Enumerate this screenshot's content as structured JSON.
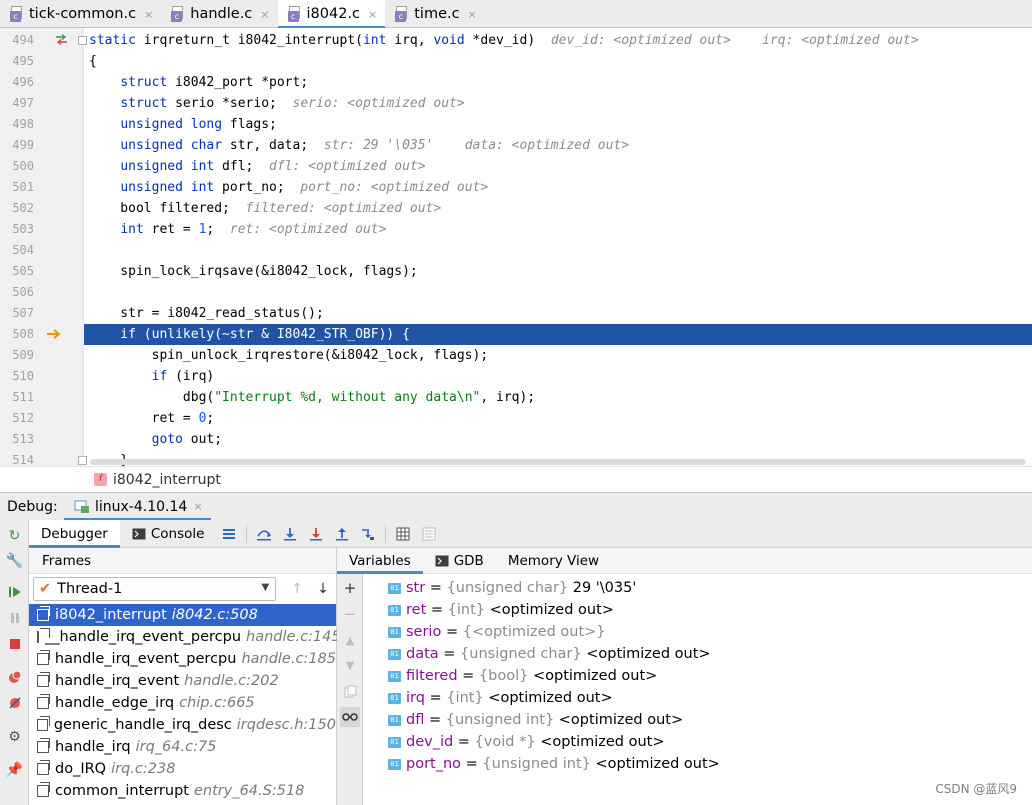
{
  "editor_tabs": [
    {
      "label": "tick-common.c",
      "active": false
    },
    {
      "label": "handle.c",
      "active": false
    },
    {
      "label": "i8042.c",
      "active": true
    },
    {
      "label": "time.c",
      "active": false
    }
  ],
  "file_icon_letter": "c",
  "close_glyph": "×",
  "code_lines": [
    {
      "num": "494",
      "code": [
        [
          "kw",
          "static "
        ],
        [
          "",
          "irqreturn_t i8042_interrupt("
        ],
        [
          "kw",
          "int"
        ],
        [
          "",
          " irq, "
        ],
        [
          "kw",
          "void"
        ],
        [
          "",
          " *dev_id)  "
        ],
        [
          "hint",
          "dev_id: <optimized out>    irq: <optimized out>"
        ]
      ]
    },
    {
      "num": "495",
      "code": [
        [
          "",
          "{"
        ]
      ]
    },
    {
      "num": "496",
      "code": [
        [
          "",
          "    "
        ],
        [
          "kw",
          "struct"
        ],
        [
          "",
          " i8042_port *port;"
        ]
      ]
    },
    {
      "num": "497",
      "code": [
        [
          "",
          "    "
        ],
        [
          "kw",
          "struct"
        ],
        [
          "",
          " serio *serio;  "
        ],
        [
          "hint",
          "serio: <optimized out>"
        ]
      ]
    },
    {
      "num": "498",
      "code": [
        [
          "",
          "    "
        ],
        [
          "kw",
          "unsigned long"
        ],
        [
          "",
          " flags;"
        ]
      ]
    },
    {
      "num": "499",
      "code": [
        [
          "",
          "    "
        ],
        [
          "kw",
          "unsigned char"
        ],
        [
          "",
          " str, data;  "
        ],
        [
          "hint",
          "str: "
        ],
        [
          "hintv",
          "29 '\\035'"
        ],
        [
          "hint",
          "    data: <optimized out>"
        ]
      ]
    },
    {
      "num": "500",
      "code": [
        [
          "",
          "    "
        ],
        [
          "kw",
          "unsigned int"
        ],
        [
          "",
          " dfl;  "
        ],
        [
          "hint",
          "dfl: <optimized out>"
        ]
      ]
    },
    {
      "num": "501",
      "code": [
        [
          "",
          "    "
        ],
        [
          "kw",
          "unsigned int"
        ],
        [
          "",
          " port_no;  "
        ],
        [
          "hint",
          "port_no: <optimized out>"
        ]
      ]
    },
    {
      "num": "502",
      "code": [
        [
          "",
          "    bool filtered;  "
        ],
        [
          "hint",
          "filtered: <optimized out>"
        ]
      ]
    },
    {
      "num": "503",
      "code": [
        [
          "",
          "    "
        ],
        [
          "kw",
          "int"
        ],
        [
          "",
          " ret = "
        ],
        [
          "numl",
          "1"
        ],
        [
          "",
          ";  "
        ],
        [
          "hint",
          "ret: <optimized out>"
        ]
      ]
    },
    {
      "num": "504",
      "code": []
    },
    {
      "num": "505",
      "code": [
        [
          "",
          "    spin_lock_irqsave(&i8042_lock, flags);"
        ]
      ]
    },
    {
      "num": "506",
      "code": []
    },
    {
      "num": "507",
      "code": [
        [
          "",
          "    str = i8042_read_status();"
        ]
      ]
    },
    {
      "num": "508",
      "code": [
        [
          "",
          "    if (unlikely(~str & I8042_STR_OBF)) {"
        ]
      ],
      "highlight": true
    },
    {
      "num": "509",
      "code": [
        [
          "",
          "        spin_unlock_irqrestore(&i8042_lock, flags);"
        ]
      ]
    },
    {
      "num": "510",
      "code": [
        [
          "",
          "        "
        ],
        [
          "kw",
          "if"
        ],
        [
          "",
          " (irq)"
        ]
      ]
    },
    {
      "num": "511",
      "code": [
        [
          "",
          "            dbg("
        ],
        [
          "str",
          "\"Interrupt %d, without any data\\n\""
        ],
        [
          "",
          ", irq);"
        ]
      ]
    },
    {
      "num": "512",
      "code": [
        [
          "",
          "        ret = "
        ],
        [
          "numl",
          "0"
        ],
        [
          "",
          ";"
        ]
      ]
    },
    {
      "num": "513",
      "code": [
        [
          "",
          "        "
        ],
        [
          "kw",
          "goto"
        ],
        [
          "",
          " out;"
        ]
      ]
    },
    {
      "num": "514",
      "code": [
        [
          "",
          "    }"
        ]
      ]
    }
  ],
  "breadcrumb": {
    "badge": "f",
    "label": "i8042_interrupt"
  },
  "debug": {
    "label": "Debug:",
    "session": "linux-4.10.14",
    "subtabs": {
      "debugger": "Debugger",
      "console": "Console"
    },
    "frames_header": "Frames",
    "thread": "Thread-1",
    "var_tabs": {
      "variables": "Variables",
      "gdb": "GDB",
      "memory": "Memory View"
    }
  },
  "frames": [
    {
      "fn": "i8042_interrupt",
      "loc": "i8042.c:508",
      "selected": true
    },
    {
      "fn": "__handle_irq_event_percpu",
      "loc": "handle.c:145"
    },
    {
      "fn": "handle_irq_event_percpu",
      "loc": "handle.c:185"
    },
    {
      "fn": "handle_irq_event",
      "loc": "handle.c:202"
    },
    {
      "fn": "handle_edge_irq",
      "loc": "chip.c:665"
    },
    {
      "fn": "generic_handle_irq_desc",
      "loc": "irqdesc.h:150"
    },
    {
      "fn": "handle_irq",
      "loc": "irq_64.c:75"
    },
    {
      "fn": "do_IRQ",
      "loc": "irq.c:238"
    },
    {
      "fn": "common_interrupt",
      "loc": "entry_64.S:518"
    }
  ],
  "variables": [
    {
      "name": "str",
      "type": "{unsigned char}",
      "value": "29 '\\035'"
    },
    {
      "name": "ret",
      "type": "{int}",
      "value": "<optimized out>"
    },
    {
      "name": "serio",
      "type": "{<optimized out>}",
      "value": ""
    },
    {
      "name": "data",
      "type": "{unsigned char}",
      "value": "<optimized out>"
    },
    {
      "name": "filtered",
      "type": "{bool}",
      "value": "<optimized out>"
    },
    {
      "name": "irq",
      "type": "{int}",
      "value": "<optimized out>"
    },
    {
      "name": "dfl",
      "type": "{unsigned int}",
      "value": "<optimized out>"
    },
    {
      "name": "dev_id",
      "type": "{void *}",
      "value": "<optimized out>"
    },
    {
      "name": "port_no",
      "type": "{unsigned int}",
      "value": "<optimized out>"
    }
  ],
  "var_badge": "01",
  "watermark": "CSDN @蓝风9",
  "colors": {
    "execution_line": "#2154a4",
    "selected_frame": "#2f65ca",
    "keyword": "#0033b3",
    "string": "#067d17",
    "tab_underline": "#4a88c7"
  }
}
